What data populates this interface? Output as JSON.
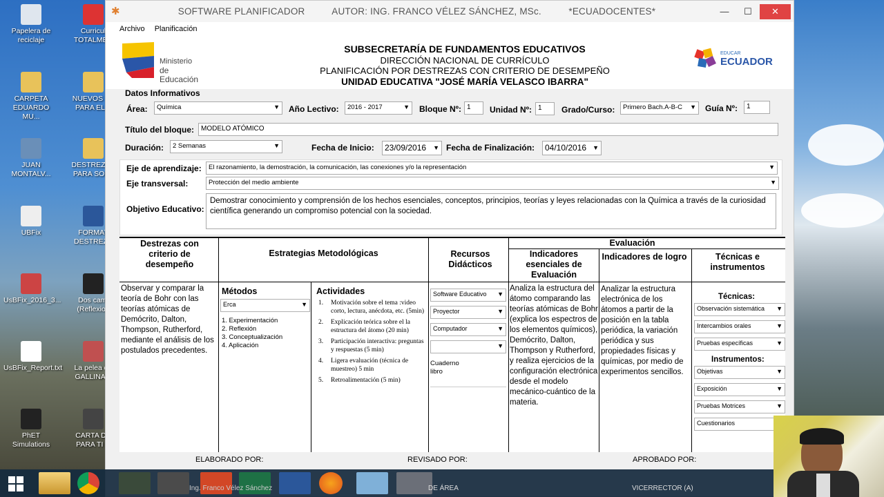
{
  "desktop": {
    "left_icons": [
      {
        "label": "Papelera de reciclaje"
      },
      {
        "label": "Curricul TOTALMEN"
      },
      {
        "label": "CARPETA EDUARDO MU..."
      },
      {
        "label": "NUEVOS TE PARA EL A"
      },
      {
        "label": "JUAN MONTALV..."
      },
      {
        "label": "DESTREZAS PARA SOFT"
      },
      {
        "label": "UBFix"
      },
      {
        "label": "FORMAT DESTREZA"
      },
      {
        "label": "UsBFix_2016_3..."
      },
      {
        "label": "Dos cami (Reflexion"
      },
      {
        "label": "UsBFix_Report.txt"
      },
      {
        "label": "La pelea de GALLINA F"
      },
      {
        "label": "PhET Simulations"
      },
      {
        "label": "CARTA DE PARA TI C"
      }
    ]
  },
  "window": {
    "title": "SOFTWARE PLANIFICADOR          AUTOR: ING. FRANCO VÉLEZ SÁNCHEZ, MSc.          *ECUADOCENTES*",
    "menu": [
      "Archivo",
      "Planificación"
    ]
  },
  "header": {
    "logo_left_line1": "Ministerio",
    "logo_left_line2": "de Educación",
    "line1": "SUBSECRETARÍA DE FUNDAMENTOS EDUCATIVOS",
    "line2": "DIRECCIÓN NACIONAL DE CURRÍCULO",
    "line3": "PLANIFICACIÓN POR DESTREZAS CON CRITERIO DE DESEMPEÑO",
    "line4": "UNIDAD EDUCATIVA \"JOSÉ MARÍA VELASCO IBARRA\"",
    "logo_right_small": "EDUCAR",
    "logo_right": "ECUADOR"
  },
  "info": {
    "section": "Datos Informativos",
    "area_label": "Área:",
    "area_value": "Química",
    "anio_label": "Año Lectivo:",
    "anio_value": "2016 - 2017",
    "bloque_label": "Bloque Nº:",
    "bloque_value": "1",
    "unidad_label": "Unidad Nº:",
    "unidad_value": "1",
    "grado_label": "Grado/Curso:",
    "grado_value": "Primero Bach.A-B-C",
    "guia_label": "Guía Nº:",
    "guia_value": "1",
    "titulo_label": "Título del bloque:",
    "titulo_value": "MODELO ATÓMICO",
    "duracion_label": "Duración:",
    "duracion_value": "2 Semanas",
    "inicio_label": "Fecha de Inicio:",
    "inicio_value": "23/09/2016",
    "fin_label": "Fecha de Finalización:",
    "fin_value": "04/10/2016",
    "eje_label": "Eje de aprendizaje:",
    "eje_value": "El razonamiento, la demostración, la comunicación, las conexiones y/o la representación",
    "transversal_label": "Eje transversal:",
    "transversal_value": "Protección del medio ambiente",
    "objetivo_label": "Objetivo Educativo:",
    "objetivo_value": "Demostrar conocimiento y comprensión de los hechos esenciales, conceptos, principios, teorías y leyes relacionadas con la Química a través de la curiosidad científica generando un compromiso potencial con la sociedad."
  },
  "table": {
    "h_destrezas": "Destrezas con criterio de desempeño",
    "h_estrategias": "Estrategias Metodológicas",
    "h_recursos": "Recursos Didácticos",
    "h_evaluacion": "Evaluación",
    "h_indicadores_esenciales": "Indicadores esenciales de Evaluación",
    "h_indicadores_logro": "Indicadores de logro",
    "h_tecnicas_instr": "Técnicas e instrumentos",
    "h_metodos": "Métodos",
    "h_actividades": "Actividades",
    "destreza_text": "Observar y comparar la teoría de Bohr con las teorías atómicas de Demócrito, Dalton, Thompson, Rutherford, mediante el análisis de los postulados precedentes.",
    "metodo_select": "Erca",
    "metodos_list": [
      "1. Experimentación",
      "2. Reflexión",
      "3. Conceptualización",
      "4. Aplicación"
    ],
    "actividades": [
      {
        "n": "1.",
        "t": "Motivación sobre el tema :video corto, lectura, anécdota, etc. (5min)"
      },
      {
        "n": "2.",
        "t": "Explicación teórica sobre el la estructura del átomo (20 min)"
      },
      {
        "n": "3.",
        "t": "Participación interactiva: preguntas y respuestas (5 min)"
      },
      {
        "n": "4.",
        "t": "Ligera evaluación (técnica de muestreo) 5 min"
      },
      {
        "n": "5.",
        "t": "Retroalimentación (5 min)"
      }
    ],
    "recursos": [
      "Software Educativo",
      "Proyector",
      "Computador",
      ""
    ],
    "recursos_extra": "Cuaderno\nlibro",
    "indicador_esencial": "Analiza la estructura del átomo comparando las teorías atómicas de Bohr (explica los espectros de los elementos químicos), Demócrito, Dalton, Thompson y Rutherford, y realiza ejercicios de la configuración electrónica desde el modelo mecánico-cuántico de la materia.",
    "indicador_logro": "Analizar la estructura electrónica de los átomos a partir de la posición en la tabla periódica, la variación periódica y sus propiedades físicas y químicas, por medio de experimentos sencillos.",
    "tecnicas_label": "Técnicas:",
    "tecnicas": [
      "Observación sistemática",
      "Intercambios orales",
      "Pruebas específicas"
    ],
    "instrumentos_label": "Instrumentos:",
    "instrumentos": [
      "Objetivas",
      "Exposición",
      "Pruebas Motrices",
      "Cuestionarios"
    ]
  },
  "footer": {
    "elaborado": "ELABORADO POR:",
    "revisado": "REVISADO POR:",
    "aprobado": "APROBADO POR:",
    "docente_partial": "Ing. Franco Vélez Sánchez",
    "area_partial": "DE ÁREA",
    "vicerrector": "VICERRECTOR (A)"
  },
  "colors": {
    "close": "#e04343",
    "window_bg": "#f0f0f0"
  }
}
